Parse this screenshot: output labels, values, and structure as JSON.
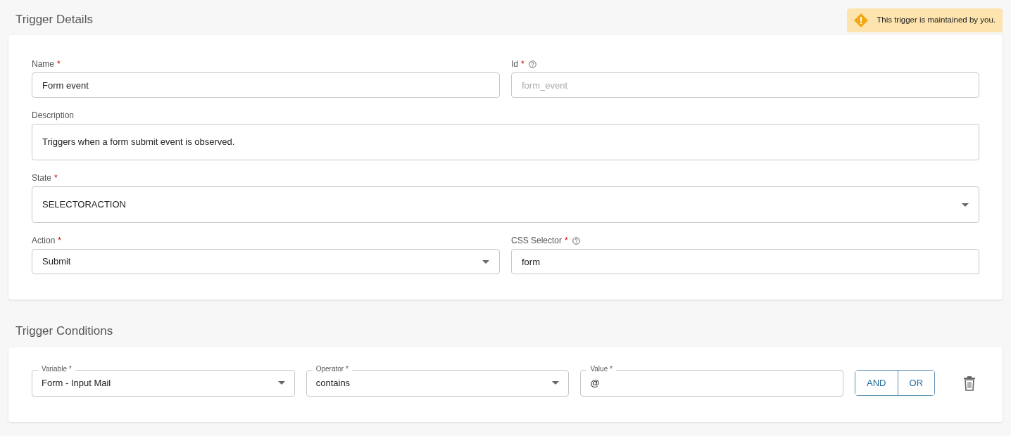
{
  "notice": {
    "text": "This trigger is maintained by you."
  },
  "details": {
    "title": "Trigger Details",
    "rows": [
      [
        {
          "kind": "text",
          "label": "Name",
          "required_mark": "*",
          "value": "Form event"
        },
        {
          "kind": "text",
          "label": "Id",
          "required_mark": "*",
          "help": true,
          "placeholder": "form_event"
        }
      ],
      [
        {
          "kind": "textarea",
          "label": "Description",
          "value": "Triggers when a form submit event is observed."
        }
      ],
      [
        {
          "kind": "select",
          "tall": true,
          "label": "State",
          "required_mark": "*",
          "value": "SELECTORACTION"
        }
      ],
      [
        {
          "kind": "select",
          "label": "Action",
          "required_mark": "*",
          "value": "Submit"
        },
        {
          "kind": "text",
          "label": "CSS Selector",
          "required_mark": "*",
          "help": true,
          "value": "form"
        }
      ]
    ]
  },
  "conditions": {
    "title": "Trigger Conditions",
    "rows": [
      {
        "fields": [
          {
            "kind": "select",
            "label": "Variable *",
            "value": "Form - Input Mail"
          },
          {
            "kind": "select",
            "label": "Operator *",
            "value": "contains"
          },
          {
            "kind": "text",
            "label": "Value *",
            "value": "@"
          }
        ],
        "logic": [
          {
            "label": "AND",
            "selected": false
          },
          {
            "label": "OR",
            "selected": false
          }
        ]
      }
    ]
  }
}
